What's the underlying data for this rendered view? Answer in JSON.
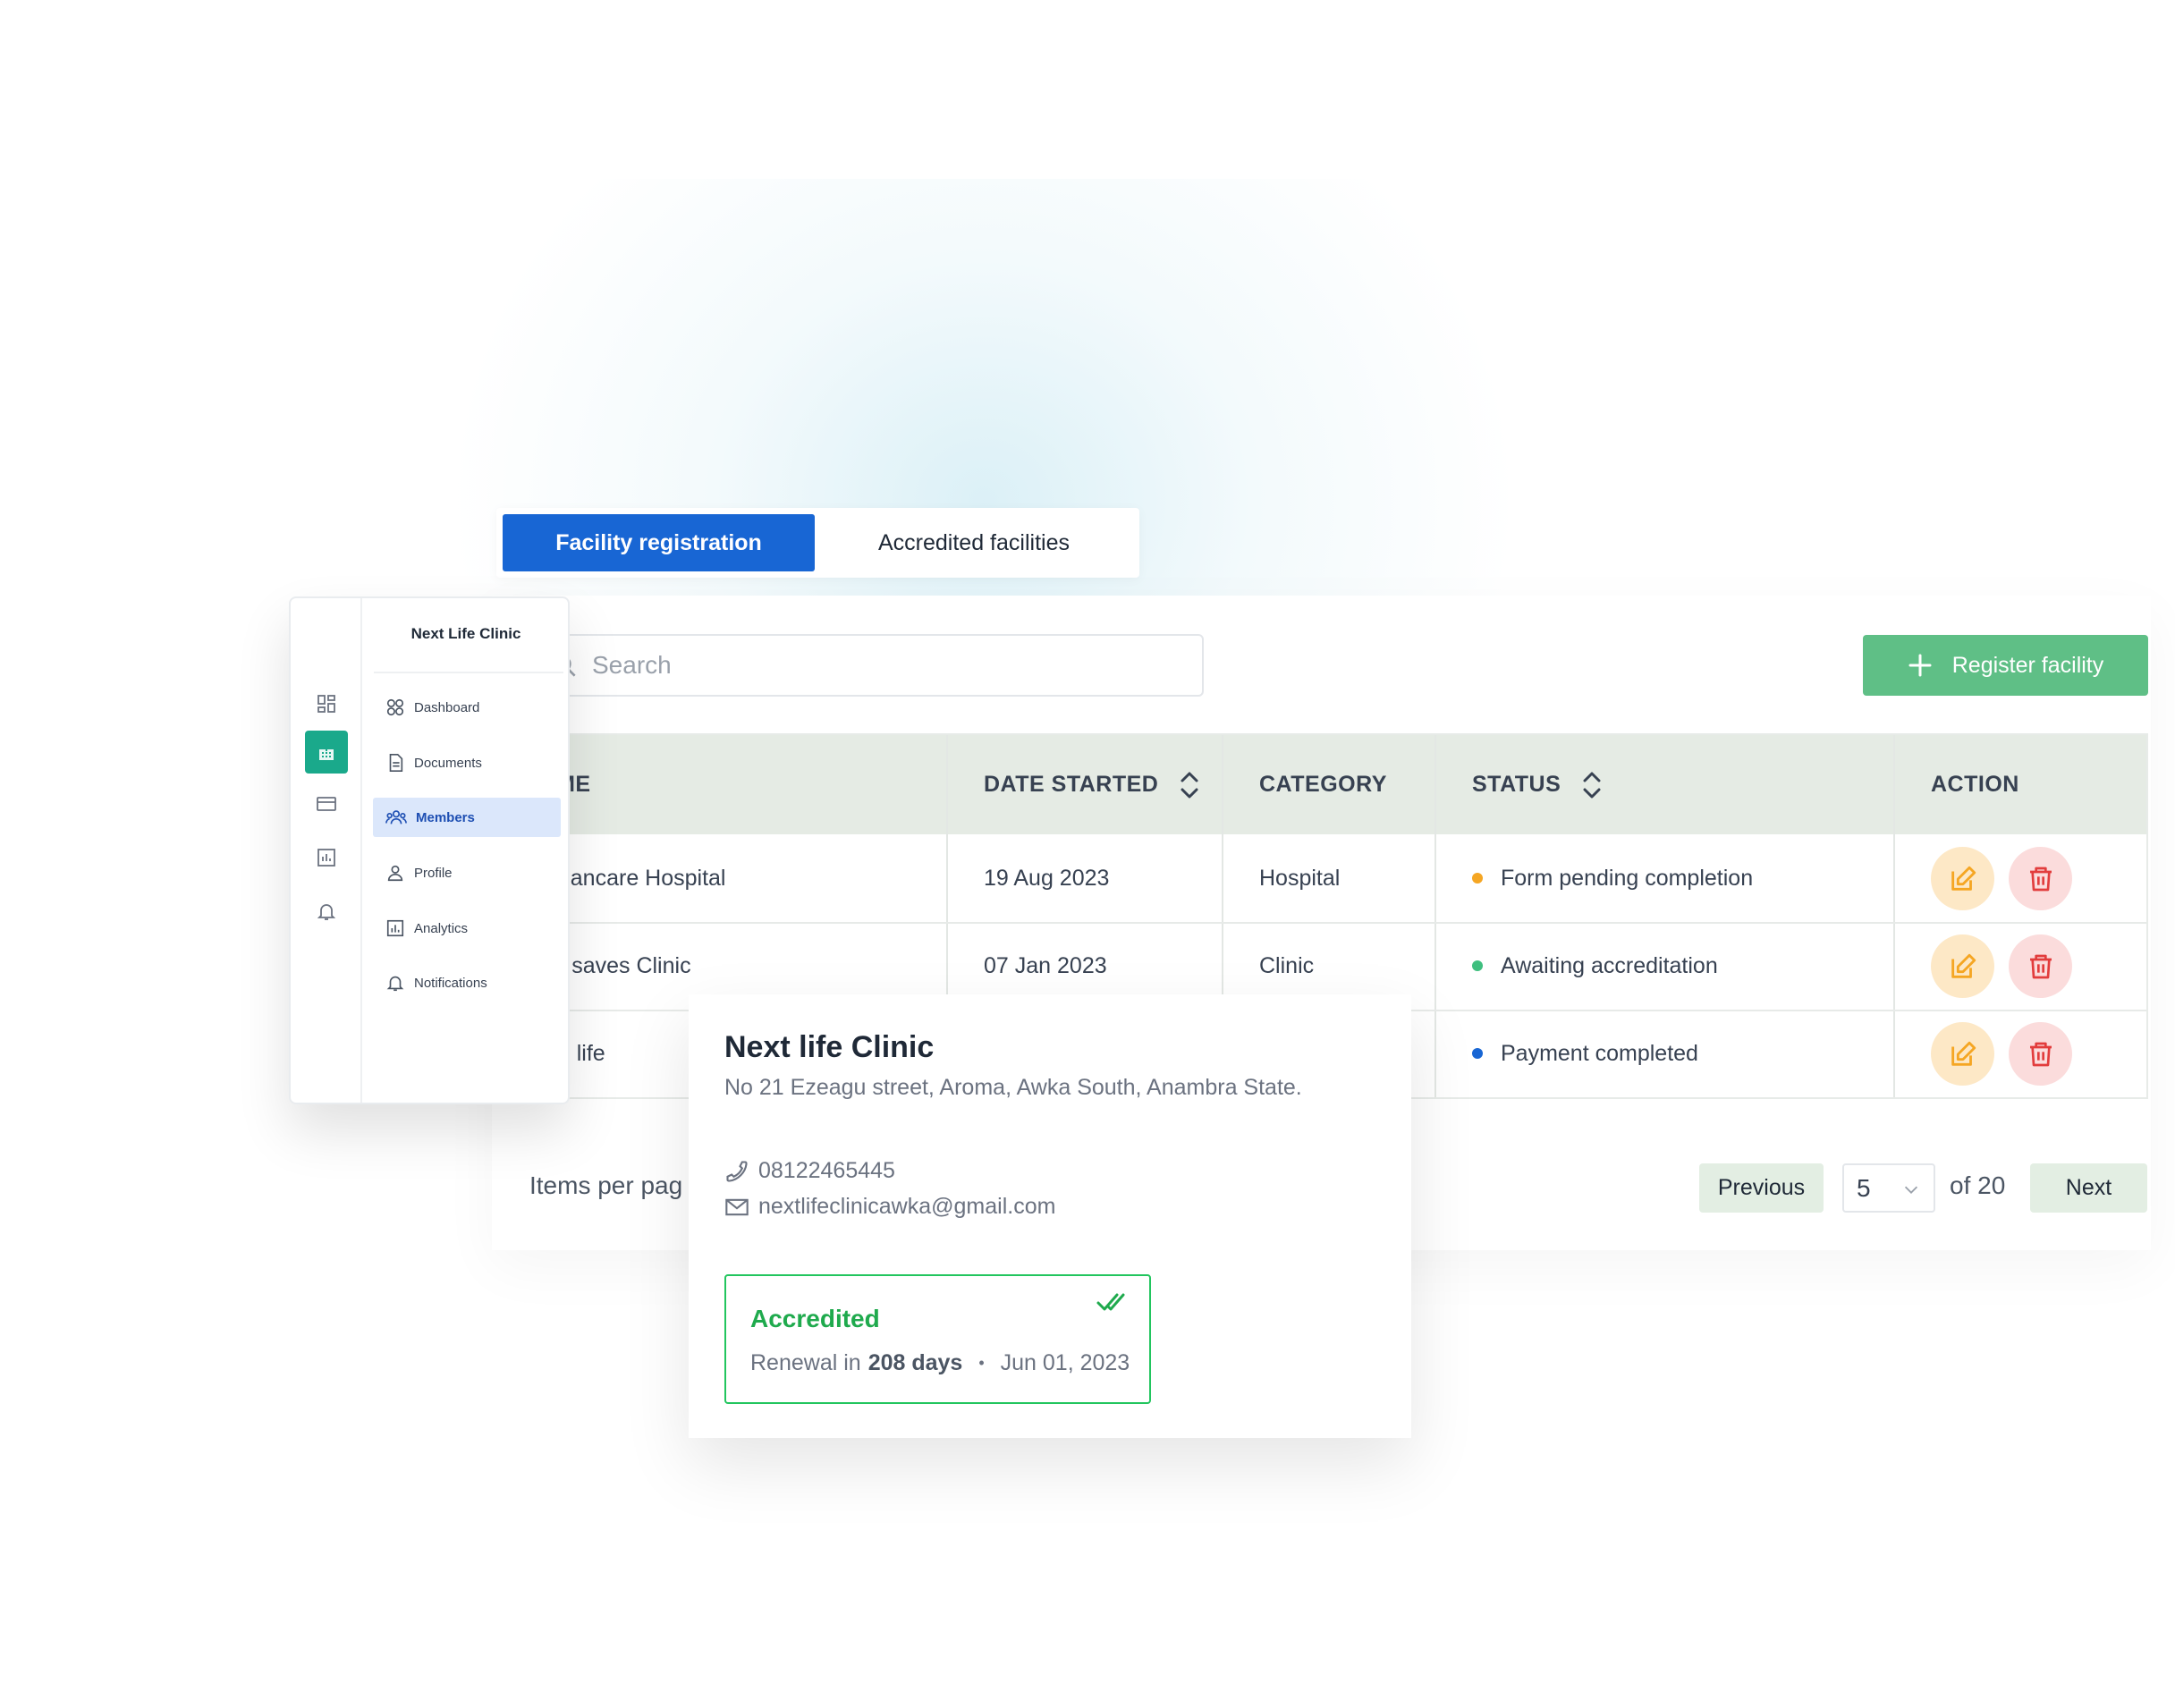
{
  "tabs": [
    {
      "label": "Facility registration",
      "active": true
    },
    {
      "label": "Accredited facilities",
      "active": false
    }
  ],
  "search": {
    "placeholder": "Search"
  },
  "register_button": {
    "label": "Register facility",
    "icon": "plus-icon"
  },
  "table": {
    "columns": [
      "NAME",
      "DATE STARTED",
      "CATEGORY",
      "STATUS",
      "ACTION"
    ],
    "rows": [
      {
        "name": "Humancare Hospital",
        "date": "19 Aug 2023",
        "category": "Hospital",
        "status": "Form pending completion",
        "status_color": "#f5a623"
      },
      {
        "name": "God saves Clinic",
        "date": "07 Jan 2023",
        "category": "Clinic",
        "status": "Awaiting accreditation",
        "status_color": "#3fbf7f"
      },
      {
        "name": "Pure life",
        "date": "",
        "category": "",
        "status": "Payment completed",
        "status_color": "#1866d4"
      }
    ]
  },
  "pagination": {
    "items_per_page_label": "Items per pag",
    "previous_label": "Previous",
    "current_page": "5",
    "of_total": "of 20",
    "next_label": "Next"
  },
  "sidebar": {
    "title": "Next Life Clinic",
    "rail_icons": [
      "grid-icon",
      "hospital-icon",
      "card-icon",
      "chart-icon",
      "bell-icon"
    ],
    "items": [
      {
        "label": "Dashboard",
        "icon": "dashboard-icon"
      },
      {
        "label": "Documents",
        "icon": "document-icon"
      },
      {
        "label": "Members",
        "icon": "members-icon",
        "active": true
      },
      {
        "label": "Profile",
        "icon": "profile-icon"
      },
      {
        "label": "Analytics",
        "icon": "analytics-icon"
      },
      {
        "label": "Notifications",
        "icon": "bell-icon"
      }
    ]
  },
  "popup": {
    "title": "Next life Clinic",
    "address": "No 21 Ezeagu street, Aroma, Awka South, Anambra State.",
    "phone": "08122465445",
    "email": "nextlifeclinicawka@gmail.com",
    "accreditation": {
      "status": "Accredited",
      "renewal_prefix": "Renewal in",
      "renewal_days": "208 days",
      "separator": "•",
      "date": "Jun 01, 2023"
    }
  },
  "colors": {
    "primary": "#1866d4",
    "success": "#5fbf86",
    "header_bg": "#e5ebe4",
    "edit": "#f5a623",
    "delete": "#e23d3d"
  }
}
